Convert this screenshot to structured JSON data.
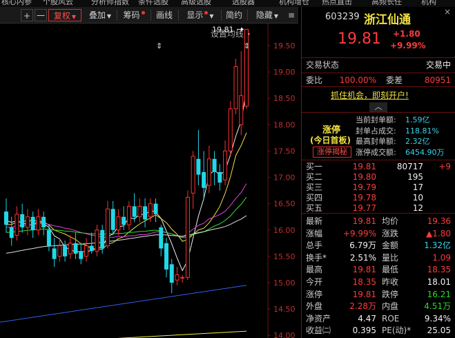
{
  "top_menu": [
    "核心内参",
    "个股风云",
    "分析师指数",
    "条件选股",
    "高级选股",
    "选股器",
    "机构增仓",
    "热点直击",
    "高频长任",
    "机构"
  ],
  "toolbar": {
    "plus": "+",
    "minus": "一",
    "adjust": "复权",
    "overlay": "叠加",
    "chips": "筹码",
    "draw": "画线",
    "display": "显示",
    "brief": "简约",
    "hide": "隐藏",
    "menu": "≡"
  },
  "chart_header": {
    "settings_ma": "设置均线",
    "marker": "⇕"
  },
  "chart_data": {
    "type": "candlestick",
    "y_ticks": [
      "19.50",
      "19.00",
      "18.50",
      "18.00",
      "17.50",
      "17.00",
      "16.50",
      "16.00",
      "15.50",
      "15.00",
      "14.50",
      "14.00"
    ],
    "ylim": [
      13.95,
      19.92
    ],
    "high_annotation": "19.81",
    "candles": [
      {
        "o": 16.35,
        "c": 16.1,
        "h": 16.6,
        "l": 15.95
      },
      {
        "o": 16.05,
        "c": 15.85,
        "h": 16.25,
        "l": 15.7
      },
      {
        "o": 15.9,
        "c": 16.3,
        "h": 16.45,
        "l": 15.8
      },
      {
        "o": 16.3,
        "c": 16.05,
        "h": 16.5,
        "l": 15.95
      },
      {
        "o": 16.05,
        "c": 16.25,
        "h": 16.4,
        "l": 15.9
      },
      {
        "o": 16.25,
        "c": 16.0,
        "h": 16.35,
        "l": 15.85
      },
      {
        "o": 16.0,
        "c": 16.25,
        "h": 16.4,
        "l": 15.9
      },
      {
        "o": 16.25,
        "c": 16.05,
        "h": 16.35,
        "l": 15.9
      },
      {
        "o": 16.0,
        "c": 15.7,
        "h": 16.1,
        "l": 15.6
      },
      {
        "o": 15.65,
        "c": 15.45,
        "h": 15.85,
        "l": 15.3
      },
      {
        "o": 15.5,
        "c": 15.7,
        "h": 15.85,
        "l": 15.4
      },
      {
        "o": 15.7,
        "c": 15.5,
        "h": 15.8,
        "l": 15.4
      },
      {
        "o": 15.55,
        "c": 15.75,
        "h": 15.9,
        "l": 15.45
      },
      {
        "o": 15.75,
        "c": 15.55,
        "h": 15.95,
        "l": 15.45
      },
      {
        "o": 15.6,
        "c": 15.45,
        "h": 15.75,
        "l": 15.35
      },
      {
        "o": 15.5,
        "c": 15.7,
        "h": 15.85,
        "l": 15.4
      },
      {
        "o": 15.7,
        "c": 15.6,
        "h": 15.95,
        "l": 15.55
      },
      {
        "o": 15.6,
        "c": 16.0,
        "h": 16.1,
        "l": 15.5
      },
      {
        "o": 16.0,
        "c": 15.65,
        "h": 16.1,
        "l": 15.55
      },
      {
        "o": 15.7,
        "c": 16.4,
        "h": 16.55,
        "l": 15.65
      },
      {
        "o": 16.4,
        "c": 16.0,
        "h": 16.55,
        "l": 15.9
      },
      {
        "o": 16.0,
        "c": 16.25,
        "h": 16.4,
        "l": 15.9
      },
      {
        "o": 16.25,
        "c": 16.1,
        "h": 16.45,
        "l": 16.0
      },
      {
        "o": 16.1,
        "c": 16.45,
        "h": 16.55,
        "l": 16.0
      },
      {
        "o": 16.45,
        "c": 16.25,
        "h": 16.7,
        "l": 16.15
      },
      {
        "o": 16.25,
        "c": 16.45,
        "h": 16.6,
        "l": 16.15
      },
      {
        "o": 16.45,
        "c": 16.2,
        "h": 16.6,
        "l": 16.05
      },
      {
        "o": 16.25,
        "c": 16.5,
        "h": 16.6,
        "l": 16.15
      },
      {
        "o": 16.5,
        "c": 16.3,
        "h": 16.6,
        "l": 16.15
      },
      {
        "o": 16.05,
        "c": 15.65,
        "h": 16.1,
        "l": 15.5
      },
      {
        "o": 15.75,
        "c": 15.25,
        "h": 15.85,
        "l": 15.1
      },
      {
        "o": 15.35,
        "c": 15.0,
        "h": 15.45,
        "l": 14.8
      },
      {
        "o": 15.05,
        "c": 15.15,
        "h": 15.3,
        "l": 14.95
      },
      {
        "o": 15.1,
        "c": 15.1,
        "h": 15.15,
        "l": 15.0
      },
      {
        "o": 15.1,
        "c": 16.62,
        "h": 16.75,
        "l": 15.05
      },
      {
        "o": 16.7,
        "c": 17.4,
        "h": 17.5,
        "l": 16.4
      },
      {
        "o": 17.35,
        "c": 17.05,
        "h": 17.9,
        "l": 16.85
      },
      {
        "o": 17.1,
        "c": 16.8,
        "h": 17.5,
        "l": 16.6
      },
      {
        "o": 16.85,
        "c": 17.35,
        "h": 17.6,
        "l": 16.7
      },
      {
        "o": 17.35,
        "c": 17.1,
        "h": 17.5,
        "l": 16.85
      },
      {
        "o": 17.1,
        "c": 16.9,
        "h": 17.25,
        "l": 16.75
      },
      {
        "o": 16.95,
        "c": 17.5,
        "h": 17.7,
        "l": 16.85
      },
      {
        "o": 17.5,
        "c": 18.3,
        "h": 18.45,
        "l": 17.4
      },
      {
        "o": 18.3,
        "c": 19.1,
        "h": 19.25,
        "l": 18.2
      },
      {
        "o": 18.0,
        "c": 18.55,
        "h": 19.4,
        "l": 17.8
      },
      {
        "o": 18.35,
        "c": 19.81,
        "h": 19.81,
        "l": 18.3
      }
    ],
    "ma_colors": [
      "#f0f0f0",
      "#f0e040",
      "#e040e0",
      "#30e030",
      "#e0e0e0",
      "#3060f0",
      "#f0f040"
    ]
  },
  "quote": {
    "code": "603239",
    "name": "浙江仙通",
    "price": "19.81",
    "change": "+1.80",
    "change_pct": "+9.99%",
    "status_label": "交易状态",
    "status_value": "交易中",
    "weibi_label": "委比",
    "weibi_value": "100.00%",
    "weicha_label": "委差",
    "weicha_value": "80951",
    "ad_link": "抓住机会，即刻开户!",
    "expand_icon": "︿",
    "limit": {
      "title": "涨停",
      "subtitle": "(今日首板)",
      "reveal_btn": "涨停揭秘",
      "items": [
        {
          "label": "当前封单额:",
          "value": "1.59亿"
        },
        {
          "label": "封单占成交:",
          "value": "118.81%"
        },
        {
          "label": "最高封单额:",
          "value": "2.32亿"
        },
        {
          "label": "涨停成交额:",
          "value": "6454.90万"
        }
      ]
    },
    "bids": [
      {
        "label": "买一",
        "price": "19.81",
        "vol": "80717",
        "delta": "+9"
      },
      {
        "label": "买二",
        "price": "19.80",
        "vol": "195",
        "delta": ""
      },
      {
        "label": "买三",
        "price": "19.79",
        "vol": "17",
        "delta": ""
      },
      {
        "label": "买四",
        "price": "19.78",
        "vol": "10",
        "delta": ""
      },
      {
        "label": "买五",
        "price": "19.77",
        "vol": "12",
        "delta": ""
      }
    ],
    "stats": [
      {
        "l1": "最新",
        "v1": "19.81",
        "c1": "red",
        "l2": "均价",
        "v2": "19.36",
        "c2": "red"
      },
      {
        "l1": "涨幅",
        "v1": "+9.99%",
        "c1": "red",
        "l2": "涨跌",
        "v2": "▲1.80",
        "c2": "red"
      },
      {
        "l1": "总手",
        "v1": "6.79万",
        "c1": "white",
        "l2": "金额",
        "v2": "1.32亿",
        "c2": "cyan"
      },
      {
        "l1": "换手*",
        "v1": "2.51%",
        "c1": "white",
        "l2": "量比",
        "v2": "1.09",
        "c2": "red"
      },
      {
        "l1": "最高",
        "v1": "19.81",
        "c1": "red",
        "l2": "最低",
        "v2": "18.35",
        "c2": "red"
      },
      {
        "l1": "今开",
        "v1": "18.35",
        "c1": "red",
        "l2": "昨收",
        "v2": "18.01",
        "c2": "white"
      },
      {
        "l1": "涨停",
        "v1": "19.81",
        "c1": "red",
        "l2": "跌停",
        "v2": "16.21",
        "c2": "green"
      },
      {
        "l1": "外盘",
        "v1": "2.28万",
        "c1": "red",
        "l2": "内盘",
        "v2": "4.51万",
        "c2": "green"
      },
      {
        "l1": "净资产",
        "v1": "4.47",
        "c1": "white",
        "l2": "ROE",
        "v2": "9.34%",
        "c2": "white"
      },
      {
        "l1": "收益㈡",
        "v1": "0.395",
        "c1": "white",
        "l2": "PE(动)*",
        "v2": "25.05",
        "c2": "white"
      }
    ]
  }
}
